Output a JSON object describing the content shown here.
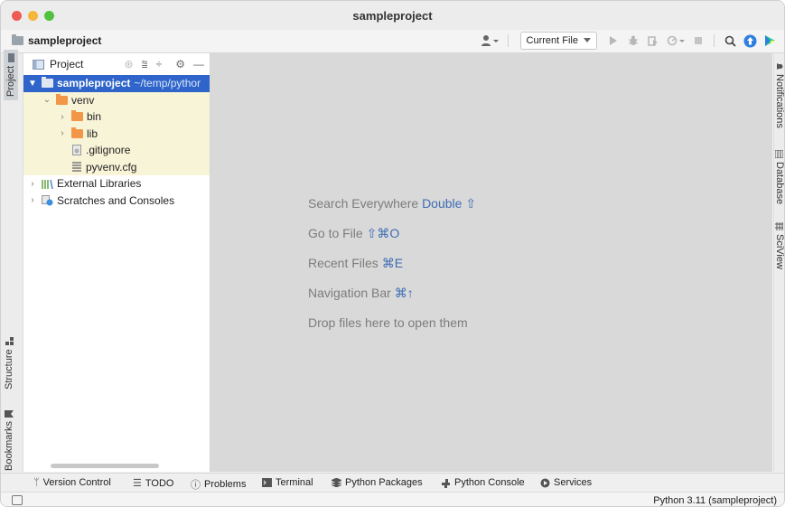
{
  "window": {
    "title": "sampleproject"
  },
  "toolbar": {
    "breadcrumb": "sampleproject",
    "run_config": "Current File",
    "icons": [
      "user-icon",
      "run-icon",
      "debug-icon",
      "coverage-icon",
      "profile-icon",
      "stop-icon",
      "search-icon",
      "update-icon",
      "jetbrains-logo-icon"
    ]
  },
  "left_stripe": {
    "project": "Project",
    "structure": "Structure",
    "bookmarks": "Bookmarks"
  },
  "project_panel": {
    "title": "Project",
    "tree": [
      {
        "label": "sampleproject",
        "path": "~/temp/pythor"
      },
      {
        "label": "venv"
      },
      {
        "label": "bin"
      },
      {
        "label": "lib"
      },
      {
        "label": ".gitignore"
      },
      {
        "label": "pyvenv.cfg"
      },
      {
        "label": "External Libraries"
      },
      {
        "label": "Scratches and Consoles"
      }
    ]
  },
  "editor": {
    "hints": [
      {
        "text": "Search Everywhere",
        "shortcut": "Double ⇧"
      },
      {
        "text": "Go to File",
        "shortcut": "⇧⌘O"
      },
      {
        "text": "Recent Files",
        "shortcut": "⌘E"
      },
      {
        "text": "Navigation Bar",
        "shortcut": "⌘↑"
      },
      {
        "text": "Drop files here to open them",
        "shortcut": ""
      }
    ]
  },
  "right_stripe": {
    "notifications": "Notifications",
    "database": "Database",
    "sciview": "SciView"
  },
  "bottom_tools": [
    "Version Control",
    "TODO",
    "Problems",
    "Terminal",
    "Python Packages",
    "Python Console",
    "Services"
  ],
  "status_bar": {
    "interpreter": "Python 3.11 (sampleproject)"
  },
  "colors": {
    "selection": "#2f65ca",
    "folder": "#f29648",
    "highlight": "#f8f4d8",
    "shortcut": "#3d6cb3"
  }
}
